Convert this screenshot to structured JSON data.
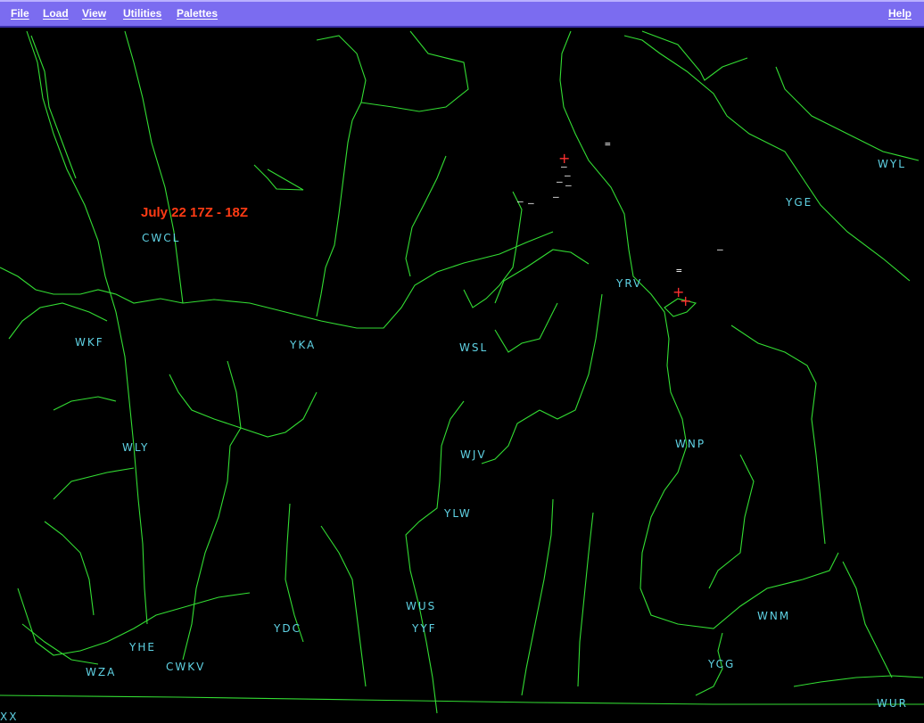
{
  "menubar": {
    "file": "File",
    "load": "Load",
    "view": "View",
    "utilities": "Utilities",
    "palettes": "Palettes",
    "help": "Help"
  },
  "map": {
    "title": "July 22 17Z - 18Z",
    "stations": [
      "CWCL",
      "WKF",
      "YKA",
      "WSL",
      "YRV",
      "YGE",
      "WYL",
      "WLY",
      "WJV",
      "WNP",
      "YLW",
      "WUS",
      "YYF",
      "YDC",
      "YHE",
      "CWKV",
      "WZA",
      "WNM",
      "YCG",
      "WUR",
      "XX"
    ],
    "colors": {
      "background": "#000000",
      "boundaries": "#33dd33",
      "station_labels": "#5fd2e4",
      "title": "#ff3b14",
      "strikes_positive": "#ff3030",
      "strikes_negative": "#ffffff",
      "menubar": "#7b6cf0"
    }
  }
}
